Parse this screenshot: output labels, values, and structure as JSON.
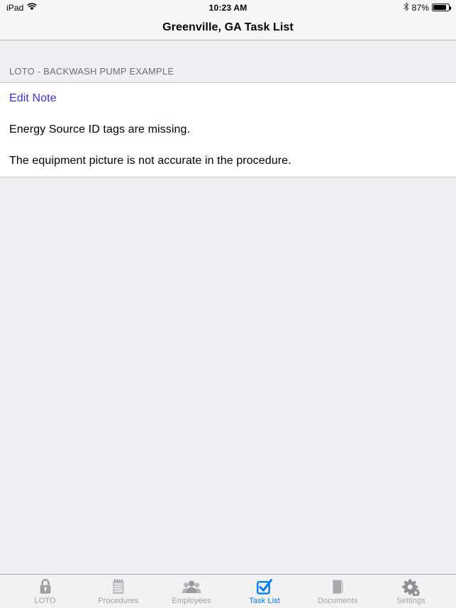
{
  "status_bar": {
    "carrier": "iPad",
    "wifi_icon": "wifi-icon",
    "time": "10:23 AM",
    "bluetooth_icon": "bluetooth-icon",
    "battery_percent": "87%",
    "battery_level": 87,
    "battery_icon": "battery-icon"
  },
  "nav_bar": {
    "title": "Greenville, GA Task List"
  },
  "content": {
    "section_header": "LOTO - BACKWASH PUMP EXAMPLE",
    "rows": [
      {
        "label": "Edit Note",
        "kind": "link"
      },
      {
        "label": "Energy Source ID tags are missing.",
        "kind": "text"
      },
      {
        "label": "The equipment picture is not accurate in the procedure.",
        "kind": "text"
      }
    ]
  },
  "tab_bar": {
    "active_index": 3,
    "active_color": "#007AFF",
    "inactive_color": "#A0A0A5",
    "items": [
      {
        "label": "LOTO",
        "icon": "padlock-icon"
      },
      {
        "label": "Procedures",
        "icon": "notepad-icon"
      },
      {
        "label": "Employees",
        "icon": "people-icon"
      },
      {
        "label": "Task List",
        "icon": "checkbox-checked-icon"
      },
      {
        "label": "Documents",
        "icon": "book-icon"
      },
      {
        "label": "Settings",
        "icon": "gears-icon"
      }
    ]
  }
}
